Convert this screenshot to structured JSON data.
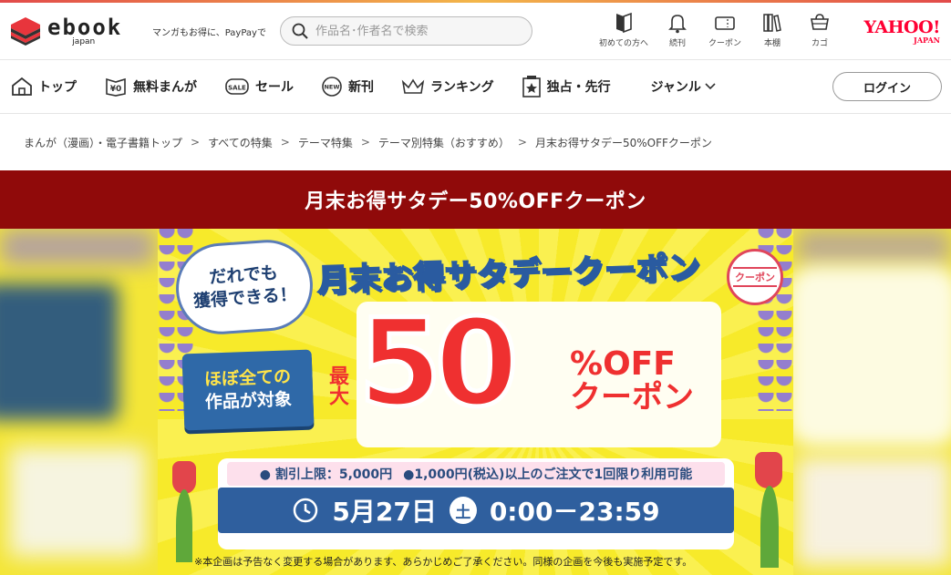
{
  "header": {
    "logo_word": "ebook",
    "logo_sub": "japan",
    "tagline": "マンガもお得に、PayPayで",
    "search_placeholder": "作品名･作者名で検索",
    "icons": [
      {
        "icon": "book-guide-icon",
        "label": "初めての方へ"
      },
      {
        "icon": "bell-icon",
        "label": "続刊"
      },
      {
        "icon": "coupon-icon",
        "label": "クーポン"
      },
      {
        "icon": "bookshelf-icon",
        "label": "本棚"
      },
      {
        "icon": "cart-icon",
        "label": "カゴ"
      }
    ],
    "yahoo": "YAHOO!",
    "yahoo_sub": "JAPAN"
  },
  "nav": {
    "items": [
      {
        "icon": "home-icon",
        "label": "トップ"
      },
      {
        "icon": "free-icon",
        "label": "無料まんが"
      },
      {
        "icon": "sale-icon",
        "label": "セール"
      },
      {
        "icon": "new-icon",
        "label": "新刊"
      },
      {
        "icon": "crown-icon",
        "label": "ランキング"
      },
      {
        "icon": "exclusive-icon",
        "label": "独占・先行"
      }
    ],
    "genre": "ジャンル",
    "login": "ログイン"
  },
  "breadcrumb": [
    "まんが（漫画）・電子書籍トップ",
    "すべての特集",
    "テーマ特集",
    "テーマ別特集（おすすめ）",
    "月末お得サタデー50%OFFクーポン"
  ],
  "breadcrumb_sep": ">",
  "page_title": "月末お得サタデー50%OFFクーポン",
  "banner": {
    "bubble_line1": "だれでも",
    "bubble_line2": "獲得できる！",
    "headline": "月末お得サタデークーポン",
    "stamp": "クーポン",
    "target_line1": "ほぼ全ての",
    "target_line2": "作品が対象",
    "max": "最大",
    "big_number": "50",
    "percent_off": "%OFF",
    "coupon": "クーポン",
    "cond1": "● 割引上限：5,000円",
    "cond2": "●1,000円(税込)以上のご注文で1回限り利用可能",
    "date": "5月27日",
    "day": "土",
    "time": "0:00－23:59",
    "note": "※本企画は予告なく変更する場合があります、あらかじめご了承ください。同様の企画を今後も実施予定です。"
  },
  "colors": {
    "title_band": "#900a0a",
    "banner_yellow": "#f7ea2a",
    "accent_red": "#ef3030",
    "accent_blue": "#2f5f9e",
    "yahoo_red": "#ff0033"
  }
}
